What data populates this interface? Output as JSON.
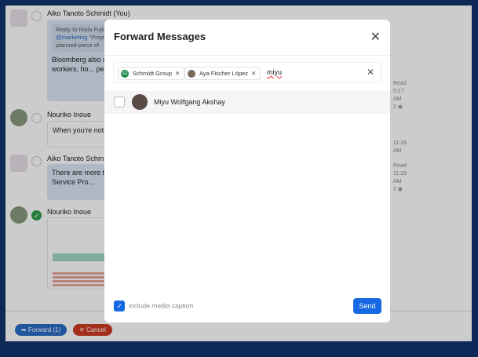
{
  "messages": [
    {
      "sender": "Aiko Tanoto Schmidt (You)",
      "reply_to": "Reply to Riyla Fujii",
      "reply_mention": "@marketing",
      "reply_text": "\"Project... a piece of work inv... a planned piece of",
      "text": "Bloomberg also r... such as not havin... food workers, ho... percent drop in t...",
      "status": "Read",
      "time": "5:17 AM",
      "views": "2"
    },
    {
      "sender": "Nouriko Inoue",
      "text": "When you're not ... your childhood, t...",
      "time": "11:28 AM"
    },
    {
      "sender": "Aiko Tanoto Schm...",
      "text": "There are more t... Lunch Program, ... Food Service Pro...",
      "status": "Read",
      "time": "11:29 AM",
      "views": "2"
    },
    {
      "sender": "Nouriko Inoue",
      "selected": true
    }
  ],
  "bottom": {
    "forward_label": "Forward (1)",
    "cancel_label": "Cancel"
  },
  "modal": {
    "title": "Forward Messages",
    "chips": [
      {
        "initials": "SG",
        "label": "Schmidt Group"
      },
      {
        "label": "Aya Fischer López"
      }
    ],
    "search_value": "miyu",
    "results": [
      {
        "name": "Miyu Wolfgang Akshay",
        "checked": false
      }
    ],
    "include_caption_label": "include media caption",
    "include_caption": true,
    "send_label": "Send"
  },
  "colors": {
    "frame": "#0c2958",
    "send": "#1668e3",
    "forward": "#2a6bc4",
    "cancel": "#cc3a21",
    "chip_group": "#1e8a4a"
  }
}
